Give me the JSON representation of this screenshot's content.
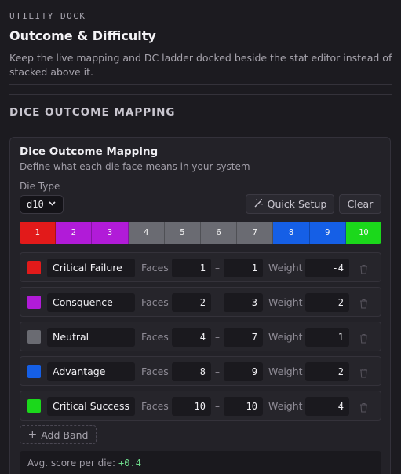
{
  "header": {
    "eyebrow": "UTILITY DOCK",
    "title": "Outcome & Difficulty",
    "subtitle": "Keep the live mapping and DC ladder docked beside the stat editor instead of stacked above it."
  },
  "section": {
    "title": "DICE OUTCOME MAPPING"
  },
  "panel": {
    "title": "Dice Outcome Mapping",
    "subtitle": "Define what each die face means in your system",
    "die_type_label": "Die Type",
    "die_type_value": "d10",
    "quick_setup_label": "Quick Setup",
    "clear_label": "Clear"
  },
  "faces": [
    {
      "label": "1",
      "color": "#e21a1a"
    },
    {
      "label": "2",
      "color": "#b11bd8"
    },
    {
      "label": "3",
      "color": "#b11bd8"
    },
    {
      "label": "4",
      "color": "#6a6b72"
    },
    {
      "label": "5",
      "color": "#6a6b72"
    },
    {
      "label": "6",
      "color": "#6a6b72"
    },
    {
      "label": "7",
      "color": "#6a6b72"
    },
    {
      "label": "8",
      "color": "#155fe6"
    },
    {
      "label": "9",
      "color": "#155fe6"
    },
    {
      "label": "10",
      "color": "#1bd81b"
    }
  ],
  "bands": [
    {
      "name": "Critical Failure",
      "color": "#e21a1a",
      "faces_label": "Faces",
      "from": "1",
      "to": "1",
      "weight_label": "Weight",
      "weight": "-4"
    },
    {
      "name": "Consquence",
      "color": "#b11bd8",
      "faces_label": "Faces",
      "from": "2",
      "to": "3",
      "weight_label": "Weight",
      "weight": "-2"
    },
    {
      "name": "Neutral",
      "color": "#6a6b72",
      "faces_label": "Faces",
      "from": "4",
      "to": "7",
      "weight_label": "Weight",
      "weight": "1"
    },
    {
      "name": "Advantage",
      "color": "#155fe6",
      "faces_label": "Faces",
      "from": "8",
      "to": "9",
      "weight_label": "Weight",
      "weight": "2"
    },
    {
      "name": "Critical Success",
      "color": "#1bd81b",
      "faces_label": "Faces",
      "from": "10",
      "to": "10",
      "weight_label": "Weight",
      "weight": "4"
    }
  ],
  "range_separator": "–",
  "add_band_label": "Add Band",
  "add_band_glyph": "+",
  "avg": {
    "label": "Avg. score per die:",
    "value": "+0.4"
  },
  "icons": {
    "quick_setup": "magic-wand-icon",
    "delete": "trash-icon",
    "select": "chevron-down-icon"
  }
}
